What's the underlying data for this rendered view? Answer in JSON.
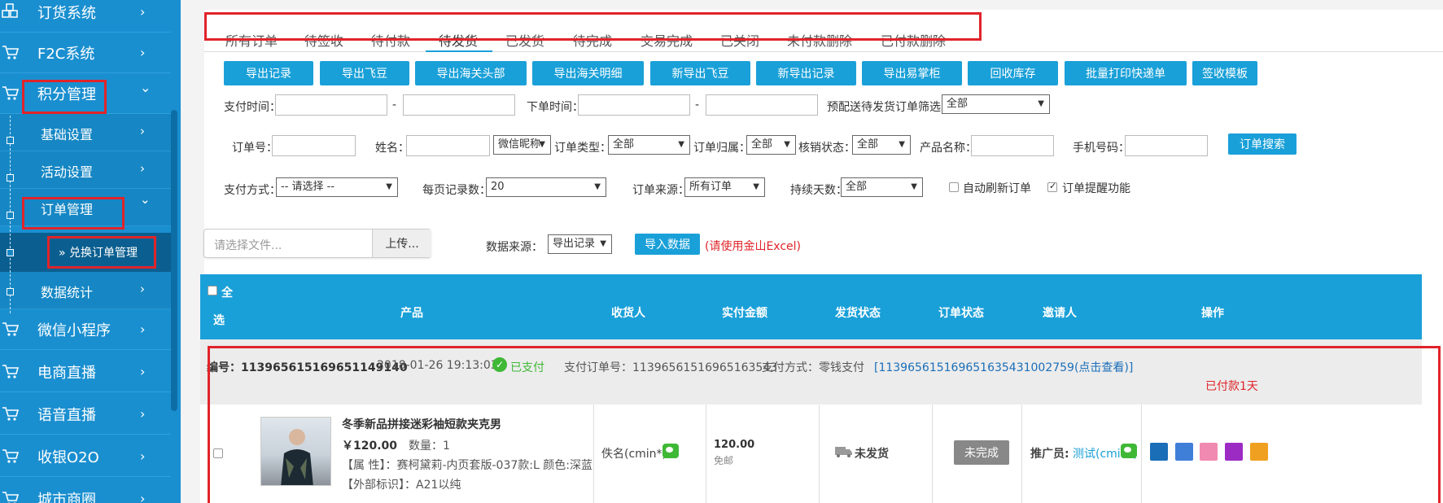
{
  "sidebar": {
    "items": [
      {
        "label": "订货系统",
        "icon": "cubes-icon"
      },
      {
        "label": "F2C系统",
        "icon": "cart-icon"
      },
      {
        "label": "积分管理",
        "icon": "cart-icon"
      },
      {
        "label": "微信小程序",
        "icon": "cart-icon"
      },
      {
        "label": "电商直播",
        "icon": "cart-icon"
      },
      {
        "label": "语音直播",
        "icon": "cart-icon"
      },
      {
        "label": "收银O2O",
        "icon": "cart-icon"
      },
      {
        "label": "城市商圈",
        "icon": "cart-icon"
      }
    ],
    "subitems": [
      {
        "label": "基础设置"
      },
      {
        "label": "活动设置"
      },
      {
        "label": "订单管理"
      },
      {
        "label": "数据统计"
      }
    ],
    "leaf": {
      "label": "兑换订单管理"
    },
    "chevron_right": "›",
    "chevron_down": "⌄"
  },
  "tabs": [
    "所有订单",
    "待签收",
    "待付款",
    "待发货",
    "已发货",
    "待完成",
    "交易完成",
    "已关闭",
    "未付款删除",
    "已付款删除"
  ],
  "toolbar": [
    "导出记录",
    "导出飞豆",
    "导出海关头部",
    "导出海关明细",
    "新导出飞豆",
    "新导出记录",
    "导出易掌柜",
    "回收库存",
    "批量打印快递单",
    "签收模板"
  ],
  "filters": {
    "pay_time": "支付时间：",
    "order_time": "下单时间：",
    "dash": "-",
    "pre_filter": "预配送待发货订单筛选：",
    "pre_filter_value": "全部",
    "order_no": "订单号：",
    "name": "姓名：",
    "nickname_value": "微信昵称",
    "order_type": "订单类型：",
    "order_type_value": "全部",
    "order_owner": "订单归属：",
    "order_owner_value": "全部",
    "verify_status": "核销状态：",
    "verify_status_value": "全部",
    "product_name": "产品名称：",
    "phone": "手机号码：",
    "search_btn": "订单搜索",
    "pay_method": "支付方式：",
    "pay_method_value": "-- 请选择 --",
    "per_page": "每页记录数：",
    "per_page_value": "20",
    "order_source": "订单来源：",
    "order_source_value": "所有订单",
    "duration": "持续天数：",
    "duration_value": "全部",
    "auto_refresh": "自动刷新订单",
    "auto_refresh_checked": false,
    "reminder": "订单提醒功能",
    "reminder_checked": true
  },
  "import": {
    "file_placeholder": "请选择文件...",
    "upload_btn": "上传...",
    "source_label": "数据来源：",
    "source_value": "导出记录",
    "import_btn": "导入数据",
    "note": "(请使用金山Excel)"
  },
  "table": {
    "select_all_1": "全",
    "select_all_2": "选",
    "headers": [
      "产品",
      "收货人",
      "实付金额",
      "发货状态",
      "订单状态",
      "邀请人",
      "操作"
    ]
  },
  "order": {
    "no_label": "编号：",
    "no": "11396561516965114914​0",
    "date": "2018-01-26 19:13:03",
    "paid": "已支付",
    "pay_order_label": "支付订单号：",
    "pay_order_no": "11396561516965163543",
    "pay_method_label": "支付方式：零钱支付",
    "pay_link": "[11396561516965163543​1002759(点击查看)]",
    "paid_days": "已付款1天",
    "product_title": "冬季新品拼接迷彩袖短款夹克男",
    "price": "￥120.00",
    "qty": "数量：1",
    "attr": "【属 性】：赛柯黛莉-内页套版-037款:L 颜色:深蓝",
    "ext_tag": "【外部标识】：A21以纯",
    "receiver": "佚名(cmin*)",
    "amount": "120.00",
    "shipping_free": "免邮",
    "ship_status": "未发货",
    "order_status": "未完成",
    "inviter_label": "推广员:",
    "inviter": "测试(cmin*)"
  },
  "colors": {
    "accent": "#1aa0d8",
    "sidebar": "#1a8fd0",
    "highlight": "#e0242a"
  }
}
